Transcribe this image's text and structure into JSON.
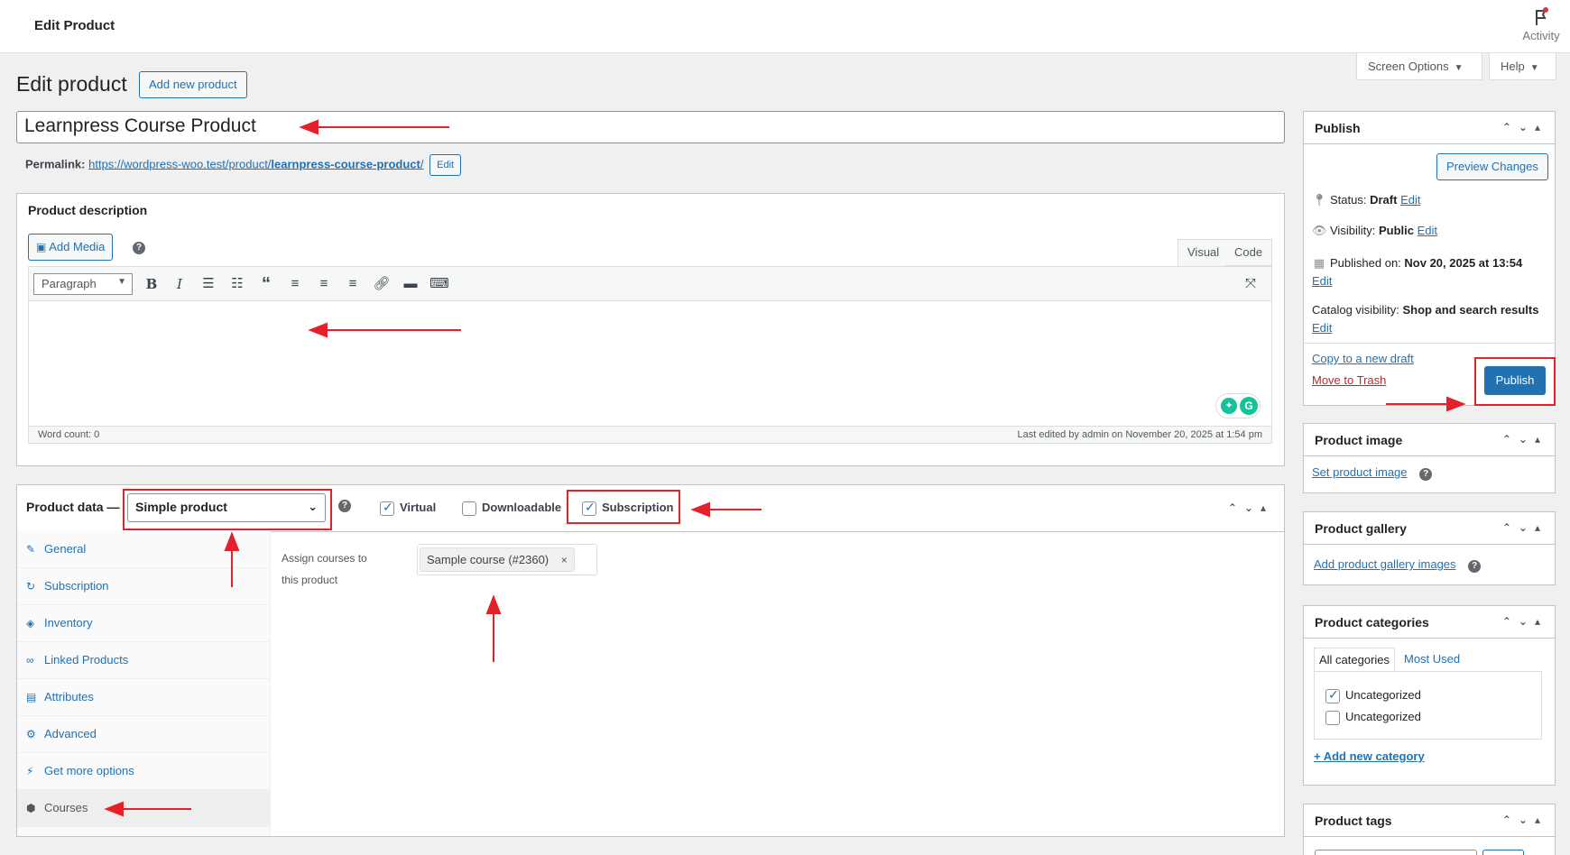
{
  "header": {
    "title": "Edit Product",
    "activity_label": "Activity"
  },
  "screen_options": {
    "label": "Screen Options",
    "help": "Help"
  },
  "page": {
    "title": "Edit product",
    "add_new": "Add new product"
  },
  "product": {
    "title": "Learnpress Course Product",
    "permalink_label": "Permalink:",
    "permalink_base": "https://wordpress-woo.test/product/",
    "permalink_slug": "learnpress-course-product",
    "permalink_end": "/",
    "permalink_edit": "Edit"
  },
  "description": {
    "heading": "Product description",
    "add_media": "Add Media",
    "tab_visual": "Visual",
    "tab_code": "Code",
    "format": "Paragraph",
    "word_count": "Word count: 0",
    "last_edited": "Last edited by admin on November 20, 2025 at 1:54 pm"
  },
  "product_data": {
    "heading": "Product data —",
    "type": "Simple product",
    "virtual": "Virtual",
    "downloadable": "Downloadable",
    "subscription": "Subscription",
    "virtual_checked": true,
    "downloadable_checked": false,
    "subscription_checked": true,
    "tabs": [
      {
        "label": "General",
        "icon": "wrench-icon"
      },
      {
        "label": "Subscription",
        "icon": "refresh-icon"
      },
      {
        "label": "Inventory",
        "icon": "tag-icon"
      },
      {
        "label": "Linked Products",
        "icon": "link-icon"
      },
      {
        "label": "Attributes",
        "icon": "list-icon"
      },
      {
        "label": "Advanced",
        "icon": "gear-icon"
      },
      {
        "label": "Get more options",
        "icon": "plug-icon"
      },
      {
        "label": "Courses",
        "icon": "cube-icon"
      }
    ],
    "active_tab": "Courses",
    "assign_label_1": "Assign courses to",
    "assign_label_2": "this product",
    "course_chip": "Sample course (#2360)",
    "chip_remove": "×"
  },
  "publish": {
    "heading": "Publish",
    "preview": "Preview Changes",
    "status_label": "Status:",
    "status_value": "Draft",
    "visibility_label": "Visibility:",
    "visibility_value": "Public",
    "published_label": "Published on:",
    "published_value": "Nov 20, 2025 at 13:54",
    "catalog_label": "Catalog visibility:",
    "catalog_value": "Shop and search results",
    "edit": "Edit",
    "copy_draft": "Copy to a new draft",
    "trash": "Move to Trash",
    "publish_btn": "Publish"
  },
  "product_image": {
    "heading": "Product image",
    "set_link": "Set product image"
  },
  "product_gallery": {
    "heading": "Product gallery",
    "add_link": "Add product gallery images"
  },
  "product_categories": {
    "heading": "Product categories",
    "tab_all": "All categories",
    "tab_most": "Most Used",
    "items": [
      {
        "label": "Uncategorized",
        "checked": true
      },
      {
        "label": "Uncategorized",
        "checked": false
      }
    ],
    "add_new": "+ Add new category"
  },
  "product_tags": {
    "heading": "Product tags"
  },
  "colors": {
    "accent": "#2271b1",
    "annotation": "#e4202b"
  }
}
